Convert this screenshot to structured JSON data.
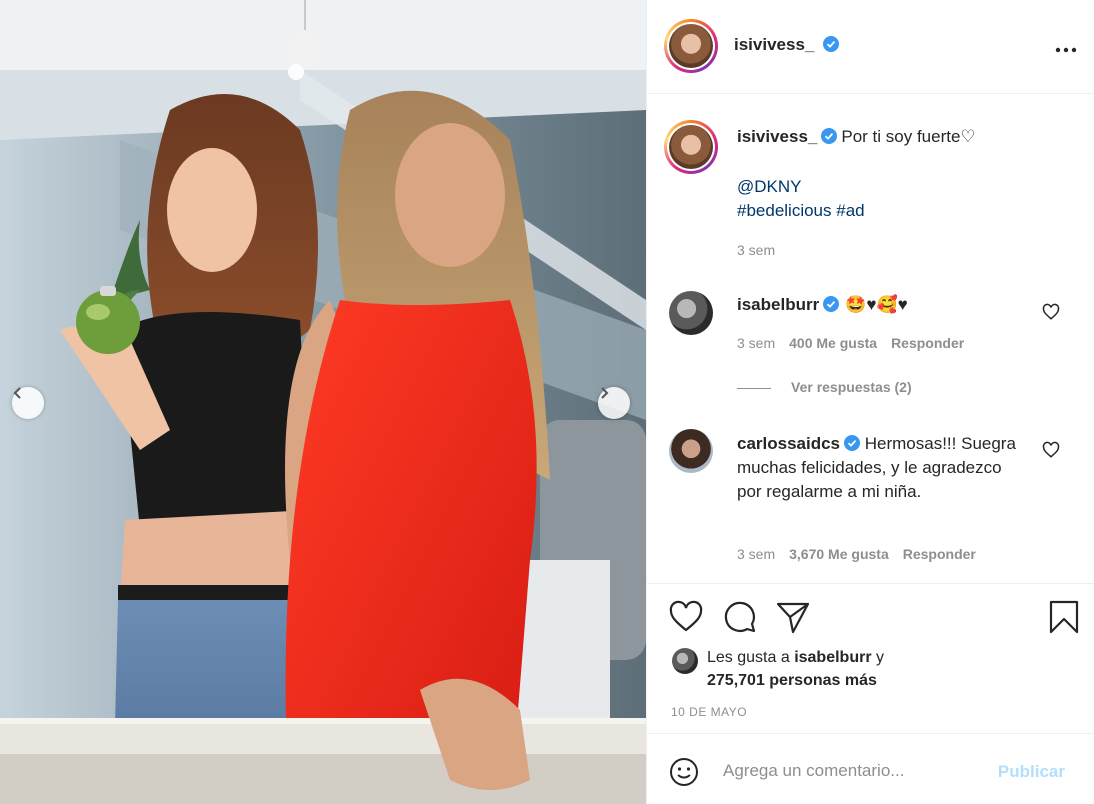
{
  "post": {
    "username": "isivivess_",
    "verified": true,
    "more_icon": "ellipsis-icon",
    "caption": {
      "text": "Por ti soy fuerte♡",
      "mention": "@DKNY",
      "hashtags": "#bedelicious #ad",
      "time": "3 sem"
    }
  },
  "comments": [
    {
      "username": "isabelburr",
      "verified": true,
      "text": "🤩♥🥰♥",
      "time": "3 sem",
      "likes": "400 Me gusta",
      "reply": "Responder",
      "view_replies": "Ver respuestas (2)"
    },
    {
      "username": "carlossaidcs",
      "verified": true,
      "text": "Hermosas!!! Suegra muchas felicidades, y le agradezco por regalarme a mi niña.",
      "time": "3 sem",
      "likes": "3,670 Me gusta",
      "reply": "Responder"
    }
  ],
  "actions": {
    "likes_prefix": "Les gusta a",
    "likes_user": "isabelburr",
    "likes_suffix": "y",
    "likes_others": "275,701 personas más",
    "date": "10 DE MAYO"
  },
  "add_comment": {
    "placeholder": "Agrega un comentario...",
    "publish_label": "Publicar"
  },
  "colors": {
    "accent_blue": "#0095f6",
    "publish_disabled": "#b2dffc",
    "link": "#00376b",
    "muted": "#8e8e8e",
    "dress_red": "#e8231b"
  }
}
